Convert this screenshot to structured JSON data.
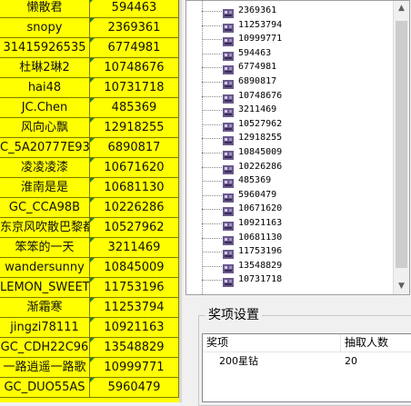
{
  "sheet": {
    "rows": [
      {
        "name": "懒散君",
        "id": "594463"
      },
      {
        "name": "snopy",
        "id": "2369361"
      },
      {
        "name": "31415926535",
        "id": "6774981"
      },
      {
        "name": "杜琳2琳2",
        "id": "10748676"
      },
      {
        "name": "hai48",
        "id": "10731718"
      },
      {
        "name": "JC.Chen",
        "id": "485369"
      },
      {
        "name": "风向心飘",
        "id": "12918255"
      },
      {
        "name": "C_5A20777E93E",
        "id": "6890817"
      },
      {
        "name": "凌凌凌漆",
        "id": "10671620"
      },
      {
        "name": "淮南是是",
        "id": "10681130"
      },
      {
        "name": "GC_CCA98B",
        "id": "10226286"
      },
      {
        "name": "东京风吹散巴黎都",
        "id": "10527962"
      },
      {
        "name": "笨笨的一天",
        "id": "3211469"
      },
      {
        "name": "wandersunny",
        "id": "10845009"
      },
      {
        "name": "LEMON_SWEET",
        "id": "11753196"
      },
      {
        "name": "渐霜寒",
        "id": "11253794"
      },
      {
        "name": "jingzi78111",
        "id": "10921163"
      },
      {
        "name": "GC_CDH22C96",
        "id": "13548829"
      },
      {
        "name": "一路逍遥一路歌",
        "id": "10999771"
      },
      {
        "name": "GC_DUO55AS",
        "id": "5960479"
      }
    ]
  },
  "tree": {
    "items": [
      "2369361",
      "11253794",
      "10999771",
      "594463",
      "6774981",
      "6890817",
      "10748676",
      "3211469",
      "10527962",
      "12918255",
      "10845009",
      "10226286",
      "485369",
      "5960479",
      "10671620",
      "10921163",
      "10681130",
      "11753196",
      "13548829",
      "10731718"
    ],
    "icon": "user-node-icon"
  },
  "prize": {
    "group_title": "奖项设置",
    "columns": [
      "奖项",
      "抽取人数"
    ],
    "rows": [
      {
        "prize": "200星钻",
        "count": "20"
      }
    ]
  }
}
